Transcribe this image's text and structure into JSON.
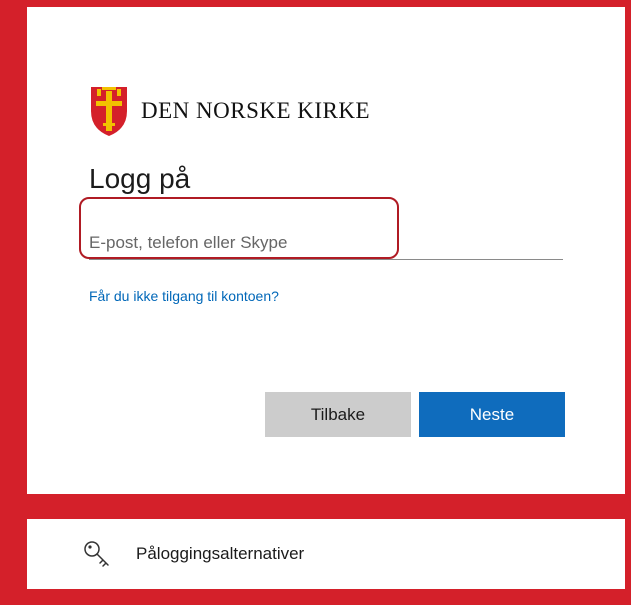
{
  "brand": {
    "name": "DEN NORSKE KIRKE",
    "logo_icon": "church-shield-icon"
  },
  "signin": {
    "title": "Logg på",
    "email_placeholder": "E-post, telefon eller Skype",
    "email_value": "",
    "help_link": "Får du ikke tilgang til kontoen?",
    "back_label": "Tilbake",
    "next_label": "Neste"
  },
  "options": {
    "label": "Påloggingsalternativer",
    "icon": "key-icon"
  },
  "colors": {
    "background": "#d4202a",
    "highlight": "#b01b24",
    "link": "#0067b8",
    "primary_button": "#0f6cbd",
    "secondary_button": "#cccccc"
  }
}
